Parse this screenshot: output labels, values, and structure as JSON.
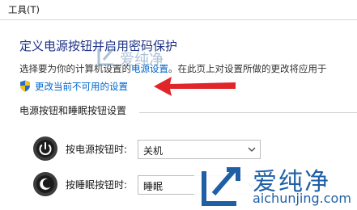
{
  "menubar": {
    "tools": "工具(T)"
  },
  "page": {
    "heading": "定义电源按钮并启用密码保护",
    "description_before": "选择要为你的计算机设置的",
    "description_link": "电源设置",
    "description_after": "。在此页上对设置所做的更改将应用于",
    "change_link": "更改当前不可用的设置",
    "section_title": "电源按钮和睡眠按钮设置",
    "power_button_label": "按电源按钮时:",
    "power_button_value": "关机",
    "sleep_button_label": "按睡眠按钮时:",
    "sleep_button_value": "睡眠"
  },
  "watermark": {
    "cn": "爱纯净",
    "url": "aichunjing.com"
  },
  "colors": {
    "heading": "#1e3287",
    "link": "#0066cc",
    "arrow": "#e0262b",
    "watermark": "#1f5fa6"
  }
}
